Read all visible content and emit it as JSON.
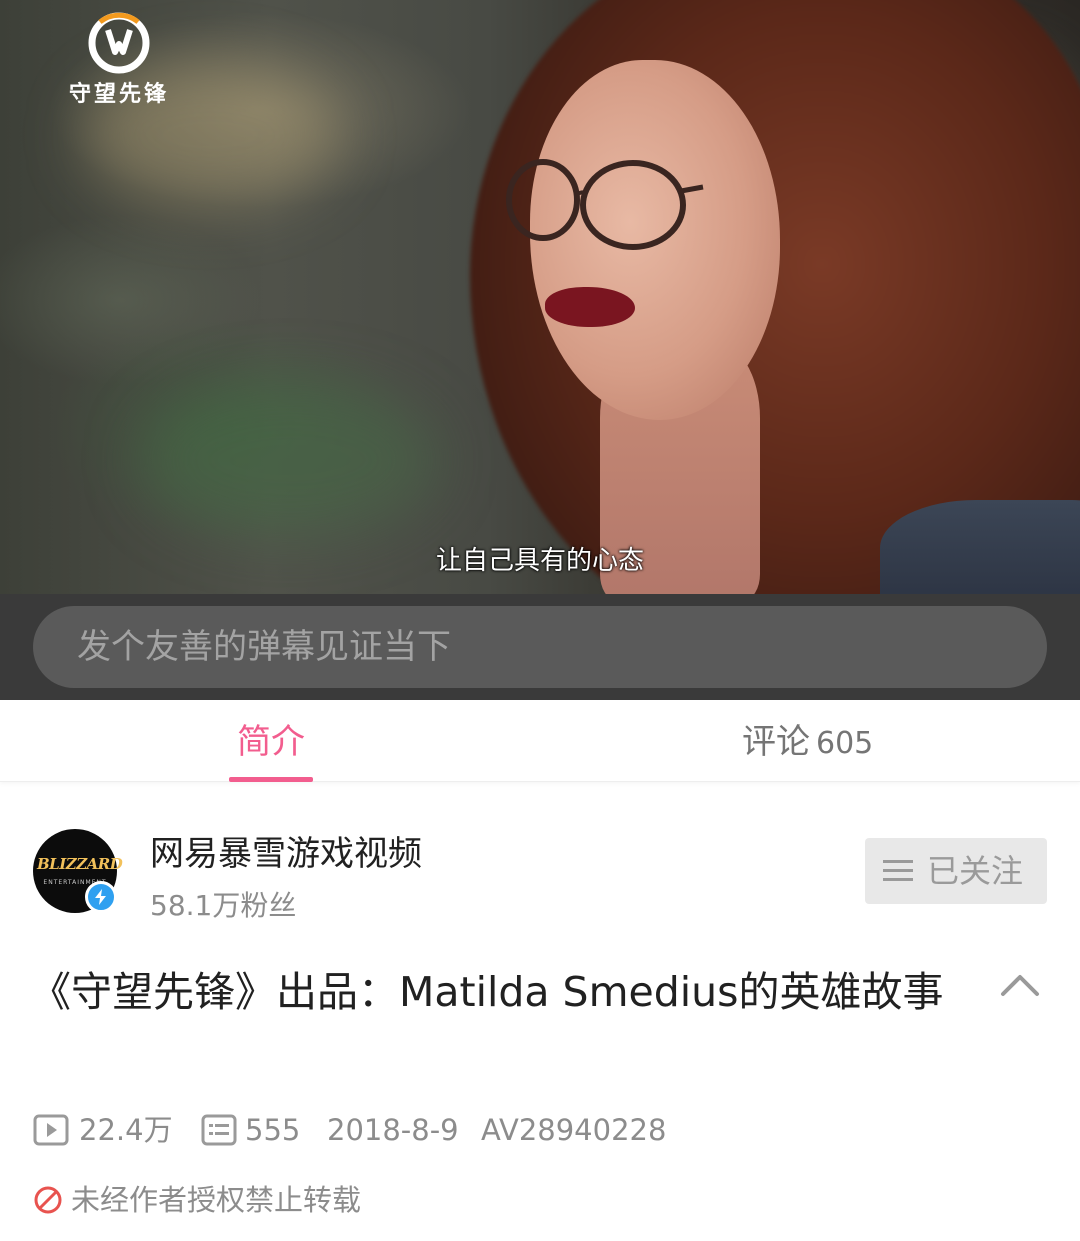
{
  "player": {
    "watermark_text": "守望先锋",
    "subtitle": "让自己具有的心态"
  },
  "danmaku": {
    "placeholder": "发个友善的弹幕见证当下"
  },
  "tabs": {
    "intro_label": "简介",
    "comments_label": "评论",
    "comments_count": "605",
    "active": "简介",
    "accent_color": "#f25d8e"
  },
  "uploader": {
    "avatar_text": "BLIZZARD",
    "avatar_subtext": "ENTERTAINMENT",
    "name": "网易暴雪游戏视频",
    "fans": "58.1万粉丝",
    "follow_label": "已关注"
  },
  "video": {
    "title": "《守望先锋》出品：Matilda Smedius的英雄故事",
    "views": "22.4万",
    "danmaku_count": "555",
    "date": "2018-8-9",
    "av_id": "AV28940228",
    "copyright_notice": "未经作者授权禁止转载"
  },
  "icons": {
    "watermark": "overwatch-logo-icon",
    "verify": "lightning-verify-icon",
    "follow": "menu-lines-icon",
    "collapse": "chevron-up-icon",
    "views": "play-icon",
    "danmaku": "danmaku-icon",
    "copyright": "prohibited-icon"
  }
}
